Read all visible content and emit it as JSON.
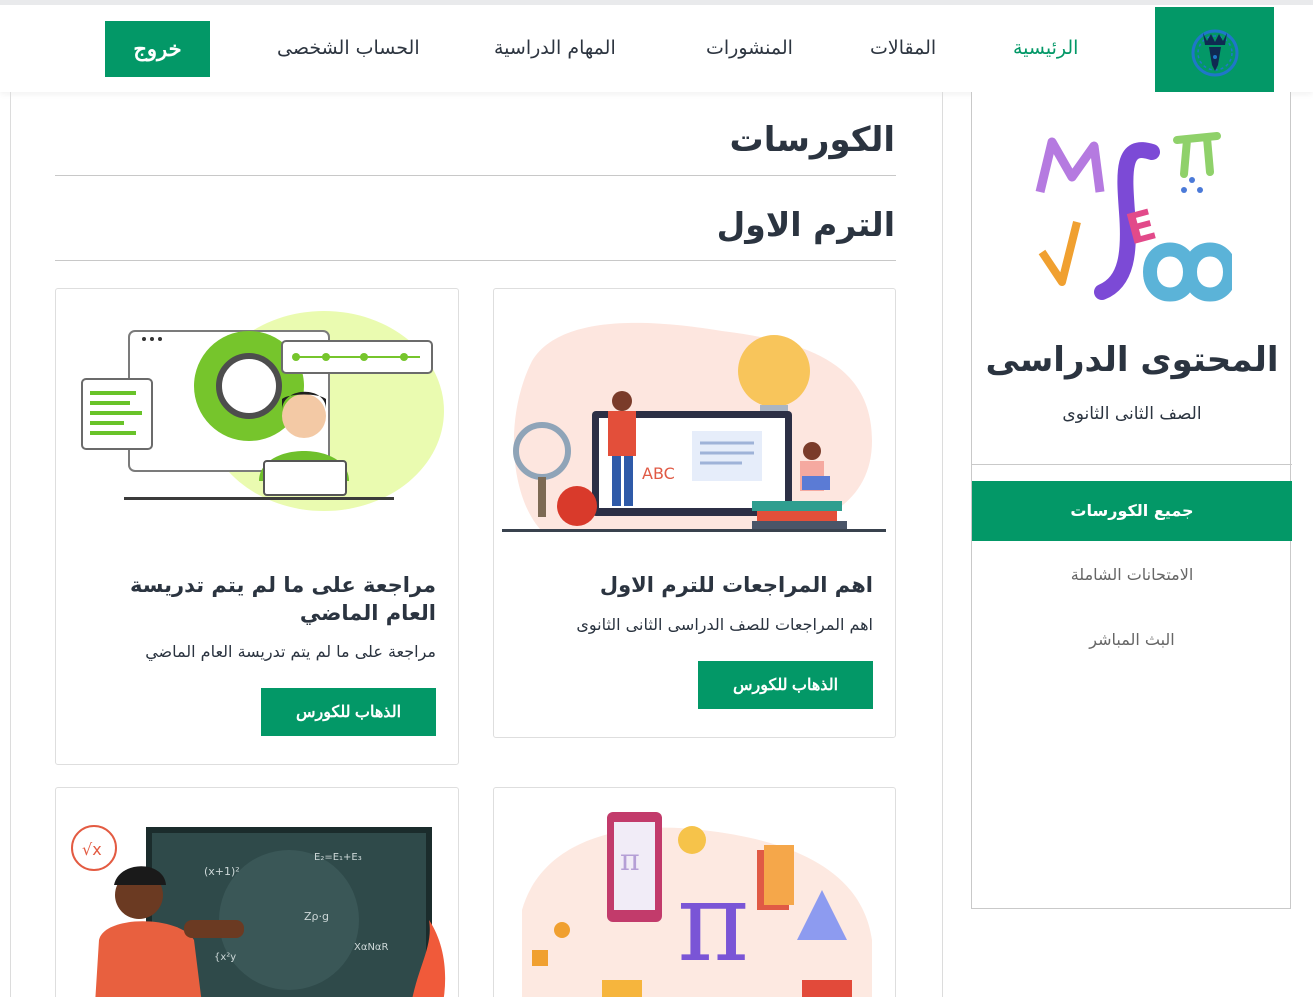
{
  "nav": {
    "items": [
      {
        "label": "الرئيسية",
        "active": true
      },
      {
        "label": "المقالات",
        "active": false
      },
      {
        "label": "المنشورات",
        "active": false
      },
      {
        "label": "المهام الدراسية",
        "active": false
      },
      {
        "label": "الحساب الشخصى",
        "active": false
      }
    ],
    "logout": "خروج",
    "logo_icon": "crowned-pen-logo-icon"
  },
  "main": {
    "title": "الكورسات",
    "term_title": "الترم الاول",
    "cards": [
      {
        "title": "اهم المراجعات للترم الاول",
        "desc": "اهم المراجعات للصف الدراسى الثانى الثانوى",
        "button": "الذهاب للكورس",
        "image": "teacher-presentation-illustration"
      },
      {
        "title": "مراجعة على ما لم يتم تدريسة العام الماضي",
        "desc": "مراجعة على ما لم يتم تدريسة العام الماضي",
        "button": "الذهاب للكورس",
        "image": "developer-gear-illustration"
      },
      {
        "title": "",
        "desc": "",
        "button": "",
        "image": "math-pi-isometric-illustration"
      },
      {
        "title": "",
        "desc": "",
        "button": "",
        "image": "teacher-chalkboard-illustration"
      }
    ]
  },
  "sidebar": {
    "title": "المحتوى الدراسى",
    "subtitle": "الصف الثانى الثانوى",
    "logo": "math-symbols-logo",
    "items": [
      {
        "label": "جميع الكورسات",
        "active": true
      },
      {
        "label": "الامتحانات الشاملة",
        "active": false
      },
      {
        "label": "البث المباشر",
        "active": false
      }
    ]
  },
  "colors": {
    "accent": "#039867",
    "text": "#2b3440"
  }
}
